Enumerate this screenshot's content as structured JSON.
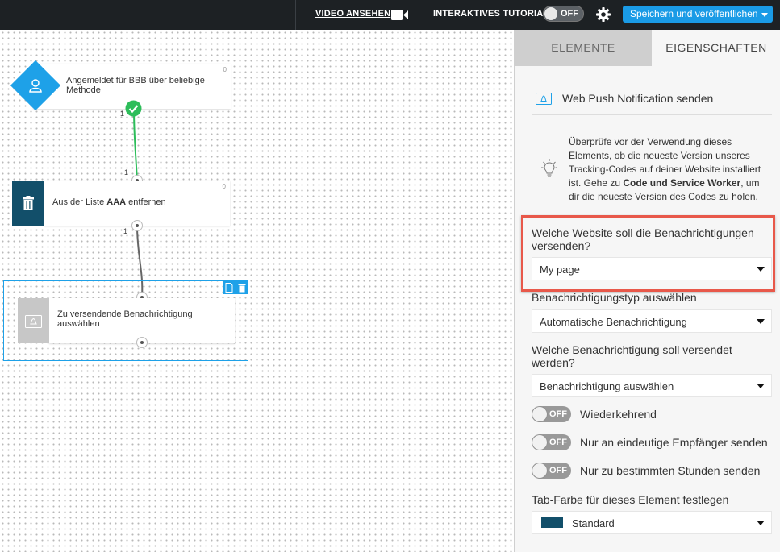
{
  "topbar": {
    "video_label": "VIDEO ANSEHEN",
    "tutorial_label": "INTERAKTIVES TUTORIAL",
    "tutorial_toggle": "OFF",
    "save_label": "Speichern und veröffentlichen",
    "accent_color": "#1a9be6"
  },
  "canvas": {
    "nodes": [
      {
        "label": "Angemeldet für BBB über beliebige Methode",
        "count": "0"
      },
      {
        "label_prefix": "Aus der Liste ",
        "label_bold": "AAA",
        "label_suffix": " entfernen",
        "count": "0"
      },
      {
        "label": "Zu versendende Benachrichtigung auswählen"
      }
    ],
    "edges": [
      "1",
      "1",
      "1"
    ]
  },
  "panel": {
    "tabs": [
      "ELEMENTE",
      "EIGENSCHAFTEN"
    ],
    "title": "Web Push Notification senden",
    "info_text_1": "Überprüfe vor der Verwendung dieses Elements, ob die neueste Version unseres Tracking-Codes auf deiner Website installiert ist. Gehe zu ",
    "info_bold": "Code und Service Worker",
    "info_text_2": ", um dir die neueste Version des Codes zu holen.",
    "website_label": "Welche Website soll die Benachrichtigungen versenden?",
    "website_value": "My page",
    "type_label": "Benachrichtigungstyp auswählen",
    "type_value": "Automatische Benachrichtigung",
    "notification_label": "Welche Benachrichtigung soll versendet werden?",
    "notification_value": "Benachrichtigung auswählen",
    "switches": [
      {
        "state": "OFF",
        "label": "Wiederkehrend"
      },
      {
        "state": "OFF",
        "label": "Nur an eindeutige Empfänger senden"
      },
      {
        "state": "OFF",
        "label": "Nur zu bestimmten Stunden senden"
      }
    ],
    "tab_color_label": "Tab-Farbe für dieses Element festlegen",
    "tab_color_value": "Standard",
    "tab_color_swatch": "#124f6a",
    "highlight_color": "#e8584a"
  }
}
